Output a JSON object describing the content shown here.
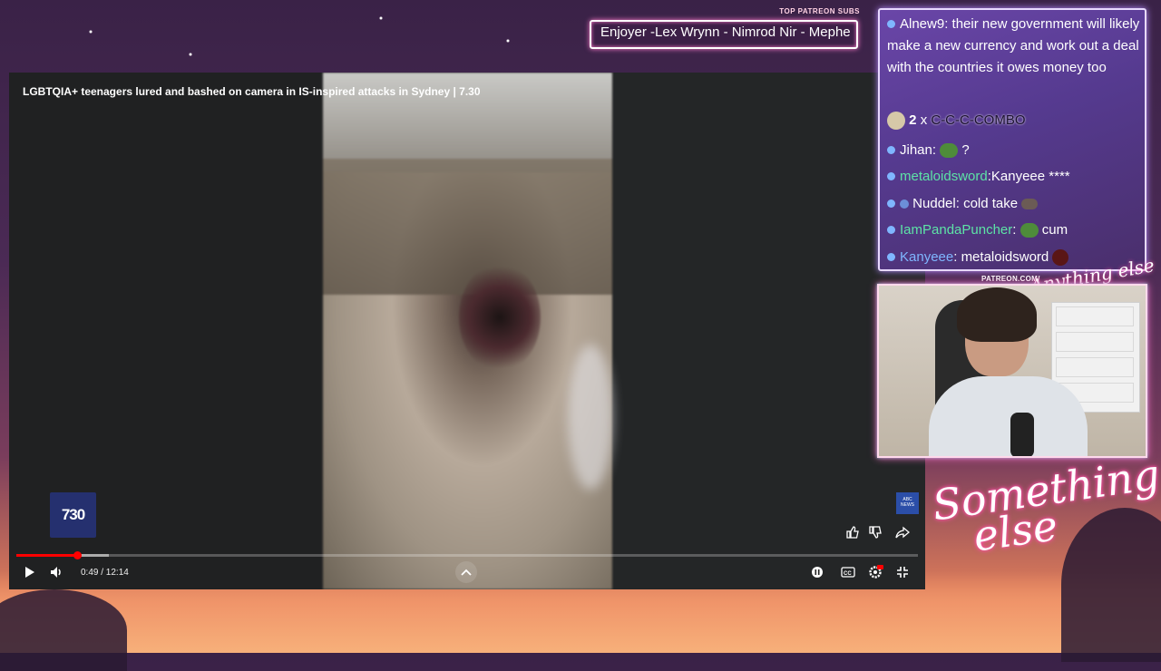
{
  "patreon": {
    "label": "TOP PATREON SUBS",
    "names": "Enjoyer -Lex Wrynn - Nimrod Nir - Mephe"
  },
  "player": {
    "title": "LGBTQIA+ teenagers lured and bashed on camera in IS-inspired attacks in Sydney | 7.30",
    "logo": "730",
    "watermark": "ABC NEWS",
    "time": "0:49 / 12:14",
    "progress_played": 0.067,
    "progress_loaded": 0.103,
    "settings_badge": "HD"
  },
  "chat": {
    "messages": [
      {
        "user": "Alnew9",
        "text": "their new government will likely make a new currency and work out a deal with the countries it owes money too"
      },
      {
        "combo_count": "2",
        "combo_x": "x",
        "combo_text": "C-C-C-COMBO"
      },
      {
        "user": "Jihan",
        "text": "?"
      },
      {
        "user": "metaloidsword",
        "text": "Kanyeee ****"
      },
      {
        "user": "Nuddel",
        "text": "cold take"
      },
      {
        "user": "IamPandaPuncher",
        "text": "cum"
      },
      {
        "user": "Kanyeee",
        "text": "metaloidsword"
      }
    ]
  },
  "webcam": {
    "label": "PATREON.COM/",
    "logo_text": "Anything else"
  },
  "brand": {
    "line1": "Something",
    "line2": "else"
  },
  "colors": {
    "progress_red": "#ff0000",
    "chat_green_user": "#5de3a6",
    "chat_blue_user": "#7fb6ff",
    "neon_pink": "#ff6ec7"
  }
}
